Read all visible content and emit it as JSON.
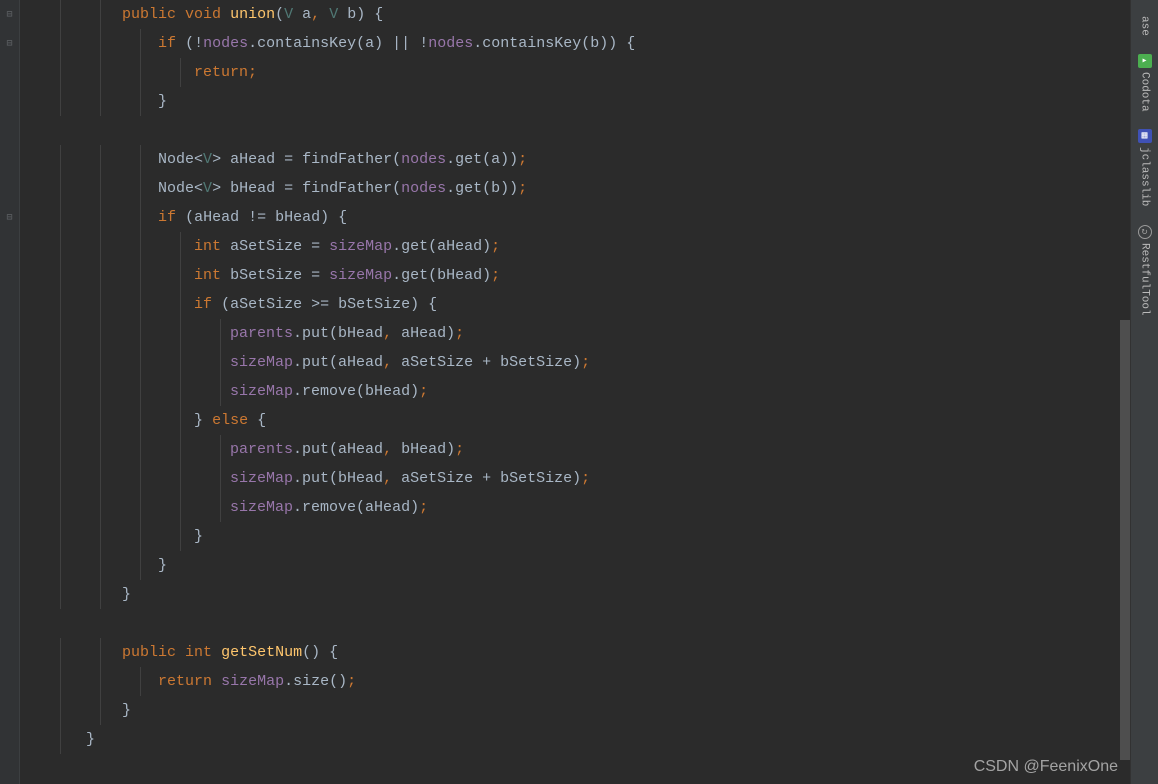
{
  "sidebar": {
    "items": [
      {
        "label": "ase",
        "icon": ""
      },
      {
        "label": "Codota",
        "icon": "codota"
      },
      {
        "label": "jclasslib",
        "icon": "jclasslib"
      },
      {
        "label": "RestfulTool",
        "icon": "restful"
      }
    ]
  },
  "code": {
    "lines": [
      {
        "indent": 2,
        "tokens": [
          {
            "t": "kw",
            "v": "public"
          },
          {
            "t": "sp",
            "v": " "
          },
          {
            "t": "kw",
            "v": "void"
          },
          {
            "t": "sp",
            "v": " "
          },
          {
            "t": "method",
            "v": "union"
          },
          {
            "t": "paren",
            "v": "("
          },
          {
            "t": "generic",
            "v": "V"
          },
          {
            "t": "sp",
            "v": " "
          },
          {
            "t": "param",
            "v": "a"
          },
          {
            "t": "punct",
            "v": ","
          },
          {
            "t": "sp",
            "v": " "
          },
          {
            "t": "generic",
            "v": "V"
          },
          {
            "t": "sp",
            "v": " "
          },
          {
            "t": "param",
            "v": "b"
          },
          {
            "t": "paren",
            "v": ")"
          },
          {
            "t": "sp",
            "v": " "
          },
          {
            "t": "paren",
            "v": "{"
          }
        ]
      },
      {
        "indent": 3,
        "tokens": [
          {
            "t": "kw",
            "v": "if"
          },
          {
            "t": "sp",
            "v": " "
          },
          {
            "t": "paren",
            "v": "(!"
          },
          {
            "t": "field",
            "v": "nodes"
          },
          {
            "t": "paren",
            "v": "."
          },
          {
            "t": "param",
            "v": "containsKey(a)"
          },
          {
            "t": "sp",
            "v": " "
          },
          {
            "t": "paren",
            "v": "||"
          },
          {
            "t": "sp",
            "v": " "
          },
          {
            "t": "paren",
            "v": "!"
          },
          {
            "t": "field",
            "v": "nodes"
          },
          {
            "t": "paren",
            "v": "."
          },
          {
            "t": "param",
            "v": "containsKey(b))"
          },
          {
            "t": "sp",
            "v": " "
          },
          {
            "t": "paren",
            "v": "{"
          }
        ]
      },
      {
        "indent": 4,
        "tokens": [
          {
            "t": "kw",
            "v": "return"
          },
          {
            "t": "punct",
            "v": ";"
          }
        ]
      },
      {
        "indent": 3,
        "tokens": [
          {
            "t": "paren",
            "v": "}"
          }
        ]
      },
      {
        "indent": 0,
        "tokens": []
      },
      {
        "indent": 3,
        "tokens": [
          {
            "t": "param",
            "v": "Node<"
          },
          {
            "t": "generic",
            "v": "V"
          },
          {
            "t": "param",
            "v": "> aHead = findFather("
          },
          {
            "t": "field",
            "v": "nodes"
          },
          {
            "t": "param",
            "v": ".get(a))"
          },
          {
            "t": "punct",
            "v": ";"
          }
        ]
      },
      {
        "indent": 3,
        "tokens": [
          {
            "t": "param",
            "v": "Node<"
          },
          {
            "t": "generic",
            "v": "V"
          },
          {
            "t": "param",
            "v": "> bHead = findFather("
          },
          {
            "t": "field",
            "v": "nodes"
          },
          {
            "t": "param",
            "v": ".get(b))"
          },
          {
            "t": "punct",
            "v": ";"
          }
        ]
      },
      {
        "indent": 3,
        "tokens": [
          {
            "t": "kw",
            "v": "if"
          },
          {
            "t": "sp",
            "v": " "
          },
          {
            "t": "param",
            "v": "(aHead != bHead) {"
          }
        ]
      },
      {
        "indent": 4,
        "tokens": [
          {
            "t": "kw",
            "v": "int"
          },
          {
            "t": "sp",
            "v": " "
          },
          {
            "t": "param",
            "v": "aSetSize = "
          },
          {
            "t": "field",
            "v": "sizeMap"
          },
          {
            "t": "param",
            "v": ".get(aHead)"
          },
          {
            "t": "punct",
            "v": ";"
          }
        ]
      },
      {
        "indent": 4,
        "tokens": [
          {
            "t": "kw",
            "v": "int"
          },
          {
            "t": "sp",
            "v": " "
          },
          {
            "t": "param",
            "v": "bSetSize = "
          },
          {
            "t": "field",
            "v": "sizeMap"
          },
          {
            "t": "param",
            "v": ".get(bHead)"
          },
          {
            "t": "punct",
            "v": ";"
          }
        ]
      },
      {
        "indent": 4,
        "tokens": [
          {
            "t": "kw",
            "v": "if"
          },
          {
            "t": "sp",
            "v": " "
          },
          {
            "t": "param",
            "v": "(aSetSize >= bSetSize) {"
          }
        ]
      },
      {
        "indent": 5,
        "tokens": [
          {
            "t": "field",
            "v": "parents"
          },
          {
            "t": "param",
            "v": ".put(bHead"
          },
          {
            "t": "punct",
            "v": ","
          },
          {
            "t": "param",
            "v": " aHead)"
          },
          {
            "t": "punct",
            "v": ";"
          }
        ]
      },
      {
        "indent": 5,
        "tokens": [
          {
            "t": "field",
            "v": "sizeMap"
          },
          {
            "t": "param",
            "v": ".put(aHead"
          },
          {
            "t": "punct",
            "v": ","
          },
          {
            "t": "param",
            "v": " aSetSize + bSetSize)"
          },
          {
            "t": "punct",
            "v": ";"
          }
        ]
      },
      {
        "indent": 5,
        "tokens": [
          {
            "t": "field",
            "v": "sizeMap"
          },
          {
            "t": "param",
            "v": ".remove(bHead)"
          },
          {
            "t": "punct",
            "v": ";"
          }
        ]
      },
      {
        "indent": 4,
        "tokens": [
          {
            "t": "paren",
            "v": "}"
          },
          {
            "t": "sp",
            "v": " "
          },
          {
            "t": "kw",
            "v": "else"
          },
          {
            "t": "sp",
            "v": " "
          },
          {
            "t": "paren",
            "v": "{"
          }
        ]
      },
      {
        "indent": 5,
        "tokens": [
          {
            "t": "field",
            "v": "parents"
          },
          {
            "t": "param",
            "v": ".put(aHead"
          },
          {
            "t": "punct",
            "v": ","
          },
          {
            "t": "param",
            "v": " bHead)"
          },
          {
            "t": "punct",
            "v": ";"
          }
        ]
      },
      {
        "indent": 5,
        "tokens": [
          {
            "t": "field",
            "v": "sizeMap"
          },
          {
            "t": "param",
            "v": ".put(bHead"
          },
          {
            "t": "punct",
            "v": ","
          },
          {
            "t": "param",
            "v": " aSetSize + bSetSize)"
          },
          {
            "t": "punct",
            "v": ";"
          }
        ]
      },
      {
        "indent": 5,
        "tokens": [
          {
            "t": "field",
            "v": "sizeMap"
          },
          {
            "t": "param",
            "v": ".remove(aHead)"
          },
          {
            "t": "punct",
            "v": ";"
          }
        ]
      },
      {
        "indent": 4,
        "tokens": [
          {
            "t": "paren",
            "v": "}"
          }
        ]
      },
      {
        "indent": 3,
        "tokens": [
          {
            "t": "paren",
            "v": "}"
          }
        ]
      },
      {
        "indent": 2,
        "tokens": [
          {
            "t": "paren",
            "v": "}"
          }
        ]
      },
      {
        "indent": 0,
        "tokens": []
      },
      {
        "indent": 2,
        "tokens": [
          {
            "t": "kw",
            "v": "public"
          },
          {
            "t": "sp",
            "v": " "
          },
          {
            "t": "kw",
            "v": "int"
          },
          {
            "t": "sp",
            "v": " "
          },
          {
            "t": "method",
            "v": "getSetNum"
          },
          {
            "t": "paren",
            "v": "()"
          },
          {
            "t": "sp",
            "v": " "
          },
          {
            "t": "paren",
            "v": "{"
          }
        ]
      },
      {
        "indent": 3,
        "tokens": [
          {
            "t": "kw",
            "v": "return"
          },
          {
            "t": "sp",
            "v": " "
          },
          {
            "t": "field",
            "v": "sizeMap"
          },
          {
            "t": "param",
            "v": ".size()"
          },
          {
            "t": "punct",
            "v": ";"
          }
        ]
      },
      {
        "indent": 2,
        "tokens": [
          {
            "t": "paren",
            "v": "}"
          }
        ]
      },
      {
        "indent": 1,
        "tokens": [
          {
            "t": "paren",
            "v": "}"
          }
        ]
      }
    ]
  },
  "watermark": "CSDN @FeenixOne"
}
